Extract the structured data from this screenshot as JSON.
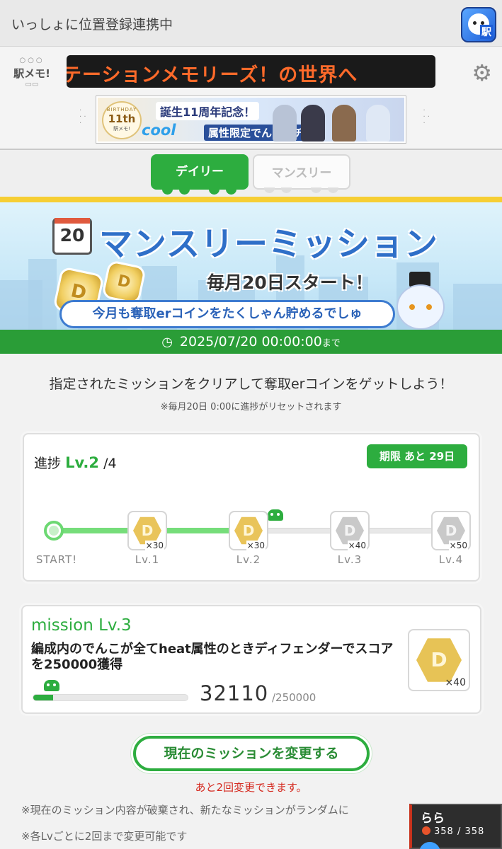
{
  "topbar": {
    "title": "いっしょに位置登録連携中",
    "app_icon_label": "駅"
  },
  "header": {
    "logo_text": "駅メモ!",
    "ticker_text": "ステーションメモリーズ！の世界へ",
    "ad": {
      "badge_top": "BIRTHDAY",
      "badge_num": "11th",
      "badge_logo": "駅メモ!",
      "line1": "誕生11周年記念！",
      "cool": "cool",
      "line2": "属性限定でんこガチャ"
    }
  },
  "tabs": [
    {
      "label": "デイリー",
      "active": true
    },
    {
      "label": "マンスリー",
      "active": false
    }
  ],
  "banner": {
    "calendar_day": "20",
    "title": "マンスリーミッション",
    "start_text": "毎月20日スタート！",
    "subtitle": "今月も奪取erコインをたくしゃん貯めるでしゅ",
    "coin_letter": "D"
  },
  "deadline": {
    "datetime": "2025/07/20 00:00:00",
    "suffix": "まで"
  },
  "intro": "指定されたミッションをクリアして奪取erコインをゲットしよう！",
  "note": "※毎月20日 0:00に進捗がリセットされます",
  "progress": {
    "label": "進捗",
    "level": "Lv.2",
    "total": "/4",
    "deadline_badge": "期限 あと 29日",
    "start_label": "START!",
    "completed_fraction": 0.5,
    "nodes": [
      {
        "label": "Lv.1",
        "qty": "×30",
        "state": "earned"
      },
      {
        "label": "Lv.2",
        "qty": "×30",
        "state": "earned"
      },
      {
        "label": "Lv.3",
        "qty": "×40",
        "state": "locked"
      },
      {
        "label": "Lv.4",
        "qty": "×50",
        "state": "locked"
      }
    ]
  },
  "mission": {
    "level": "mission Lv.3",
    "description": "編成内のでんこが全てheat属性のときディフェンダーでスコアを250000獲得",
    "current": "32110",
    "target": "/250000",
    "progress_ratio": 0.128,
    "reward_qty": "×40"
  },
  "change_button": "現在のミッションを変更する",
  "remaining": "あと2回変更できます。",
  "footnotes": [
    "※現在のミッション内容が破棄され、新たなミッションがランダムに",
    "※各Lvごとに2回まで変更可能です"
  ],
  "overlay": {
    "name": "らら",
    "hp": "358 / 358"
  },
  "colors": {
    "accent": "#2dad3f",
    "warning": "#d52a20",
    "ticker": "#ff6a2a",
    "title_blue": "#2f6fc8"
  }
}
